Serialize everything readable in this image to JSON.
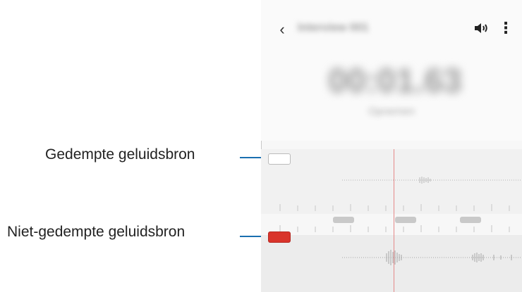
{
  "callouts": {
    "muted_source": "Gedempte geluidsbron",
    "unmuted_source": "Niet-gedempte geluidsbron"
  },
  "header": {
    "back_icon": "chevron-left-icon",
    "title": "Interview 001",
    "speaker_icon": "speaker-icon",
    "more_icon": "more-vertical-icon",
    "more_glyph": "⋮",
    "back_glyph": "‹"
  },
  "timer": {
    "elapsed": "00:01.63",
    "status": "Opnemen"
  },
  "colors": {
    "leader_line": "#1a6fb0",
    "muted_chip": "#ffffff",
    "unmuted_chip": "#d9342b",
    "playhead": "#e58a8a"
  }
}
